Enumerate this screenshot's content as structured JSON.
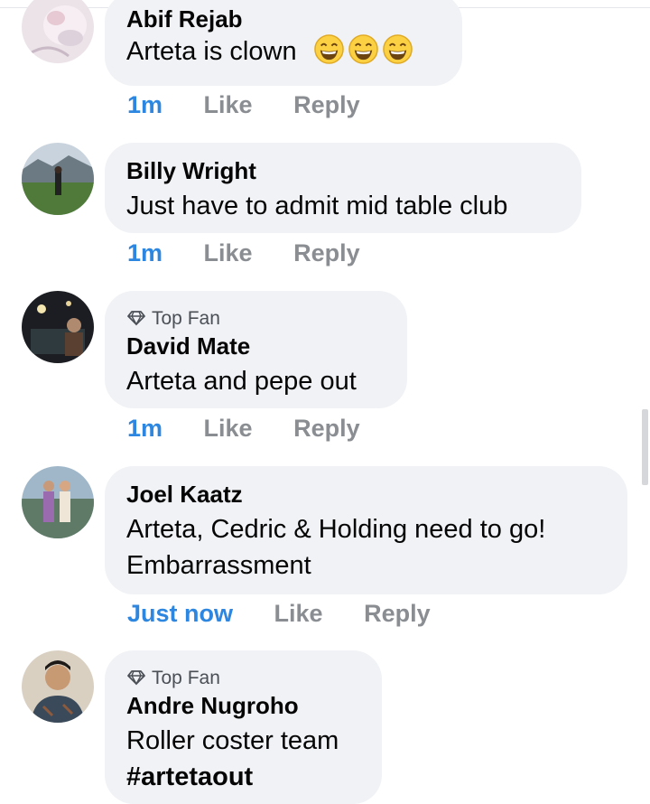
{
  "comments": [
    {
      "name": "Abif Rejab",
      "text": "Arteta is clown",
      "emojis": [
        "grinning-face-emoji",
        "grinning-face-emoji",
        "grinning-face-emoji"
      ],
      "time": "1m",
      "like": "Like",
      "reply": "Reply"
    },
    {
      "name": "Billy Wright",
      "text": "Just have to admit mid table club",
      "time": "1m",
      "like": "Like",
      "reply": "Reply"
    },
    {
      "badge": "Top Fan",
      "name": "David Mate",
      "text": "Arteta and pepe out",
      "time": "1m",
      "like": "Like",
      "reply": "Reply"
    },
    {
      "name": "Joel Kaatz",
      "text_line1": "Arteta, Cedric & Holding need to go!",
      "text_line2": "Embarrassment",
      "time": "Just now",
      "like": "Like",
      "reply": "Reply"
    },
    {
      "badge": "Top Fan",
      "name": "Andre Nugroho",
      "text_line1": "Roller coster team",
      "hashtag": "#artetaout"
    }
  ],
  "colors": {
    "bubble": "#f0f2f5",
    "timestamp": "#2d86e0",
    "action": "#8a8d91",
    "text": "#050505"
  }
}
